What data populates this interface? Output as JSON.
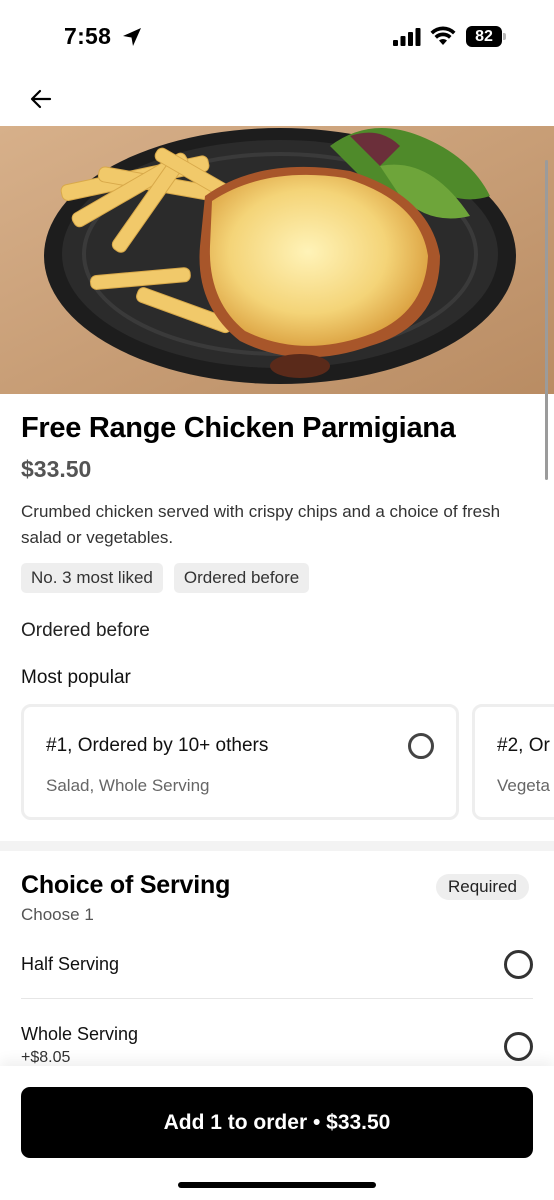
{
  "status_bar": {
    "time": "7:58",
    "battery": "82",
    "icons": [
      "location-arrow-icon",
      "signal-icon",
      "wifi-icon",
      "battery-icon"
    ]
  },
  "nav": {
    "back_icon": "arrow-left-icon"
  },
  "item": {
    "title": "Free Range Chicken Parmigiana",
    "price": "$33.50",
    "description": "Crumbed chicken served with crispy chips and a choice of fresh salad or vegetables.",
    "tags": [
      "No. 3 most liked",
      "Ordered before"
    ]
  },
  "ordered_before_label": "Ordered before",
  "most_popular": {
    "heading": "Most popular",
    "cards": [
      {
        "title": "#1, Ordered by 10+ others",
        "subtitle": "Salad, Whole Serving"
      },
      {
        "title": "#2, Or",
        "subtitle": "Vegeta"
      }
    ]
  },
  "serving": {
    "title": "Choice of Serving",
    "badge": "Required",
    "instruction": "Choose 1",
    "options": [
      {
        "label": "Half Serving",
        "price": ""
      },
      {
        "label": "Whole Serving",
        "price": "+$8.05"
      }
    ]
  },
  "cta": {
    "label": "Add 1 to order • $33.50"
  },
  "colors": {
    "primary": "#000000",
    "chip_bg": "#eeeeee",
    "text_muted": "#545454"
  }
}
